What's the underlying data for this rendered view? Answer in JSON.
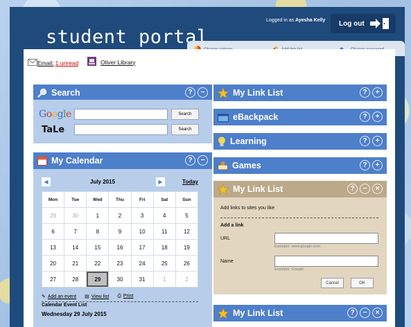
{
  "header": {
    "title": "student portal",
    "logged_in_prefix": "Logged in as",
    "user_name": "Ayesha Kelly",
    "logout_label": "Log out"
  },
  "toolbar": {
    "change_colours": "Change colours",
    "add_link_list": "Add link list",
    "change_password": "Change password"
  },
  "topbar": {
    "email_label": "Email:",
    "unread_label": "1 unread",
    "library_label": "Oliver Library"
  },
  "search": {
    "title": "Search",
    "google_button": "Search",
    "tale_button": "Search",
    "tale_label": "TaLe"
  },
  "calendar": {
    "title": "My Calendar",
    "icon_day": "29",
    "month_label": "July 2015",
    "today_label": "Today",
    "weekdays": [
      "Mon",
      "Tue",
      "Wed",
      "Thu",
      "Fri",
      "Sat",
      "Sun"
    ],
    "weeks": [
      [
        "29",
        "30",
        "1",
        "2",
        "3",
        "4",
        "5"
      ],
      [
        "6",
        "7",
        "8",
        "9",
        "10",
        "11",
        "12"
      ],
      [
        "13",
        "14",
        "15",
        "16",
        "17",
        "18",
        "19"
      ],
      [
        "20",
        "21",
        "22",
        "23",
        "24",
        "25",
        "26"
      ],
      [
        "27",
        "28",
        "29",
        "30",
        "31",
        "1",
        "2"
      ]
    ],
    "add_event": "Add an event",
    "view_list": "View list",
    "print": "Print",
    "event_list_title": "Calendar Event List",
    "event_date": "Wednesday 29 July 2015"
  },
  "widgets": {
    "my_link_list": "My Link List",
    "ebackpack": "eBackpack",
    "learning": "Learning",
    "games": "Games",
    "my_link_list_edit": "My Link List",
    "my_link_list_bottom": "My Link List"
  },
  "link_form": {
    "intro": "Add links to sites you like",
    "section": "Add a link",
    "url_label": "URL",
    "url_hint": "Example: www.google.com",
    "name_label": "Name",
    "name_hint": "Example: Google",
    "cancel": "Cancel",
    "ok": "OK"
  },
  "colors": {
    "portal_bg": "#1f4a7c",
    "panel_header": "#4e7fcb",
    "panel_body": "#b7cdea",
    "edit_header": "#bba98a",
    "edit_body": "#e2d6c0",
    "unread": "#cc0000"
  }
}
